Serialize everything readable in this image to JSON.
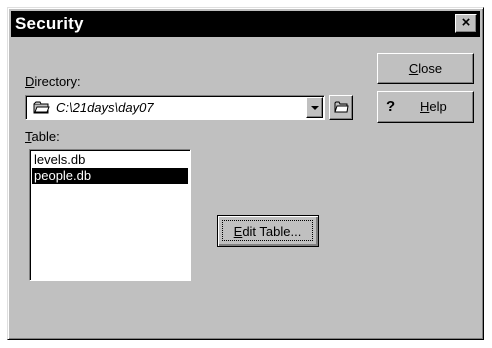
{
  "window": {
    "title": "Security",
    "close_glyph": "×"
  },
  "directory": {
    "label_underlined": "D",
    "label_rest": "irectory:",
    "value": "C:\\21days\\day07",
    "icon": "folder-icon"
  },
  "table": {
    "label_underlined": "T",
    "label_rest": "able:",
    "items": [
      "levels.db",
      "people.db"
    ],
    "selected_index": 1
  },
  "buttons": {
    "close_underlined": "C",
    "close_rest": "lose",
    "help_glyph": "?",
    "help_underlined": "H",
    "help_rest": "elp",
    "edit_underlined": "E",
    "edit_rest": "dit Table..."
  },
  "colors": {
    "face": "#c0c0c0",
    "titlebar": "#000000",
    "selection": "#000000"
  }
}
